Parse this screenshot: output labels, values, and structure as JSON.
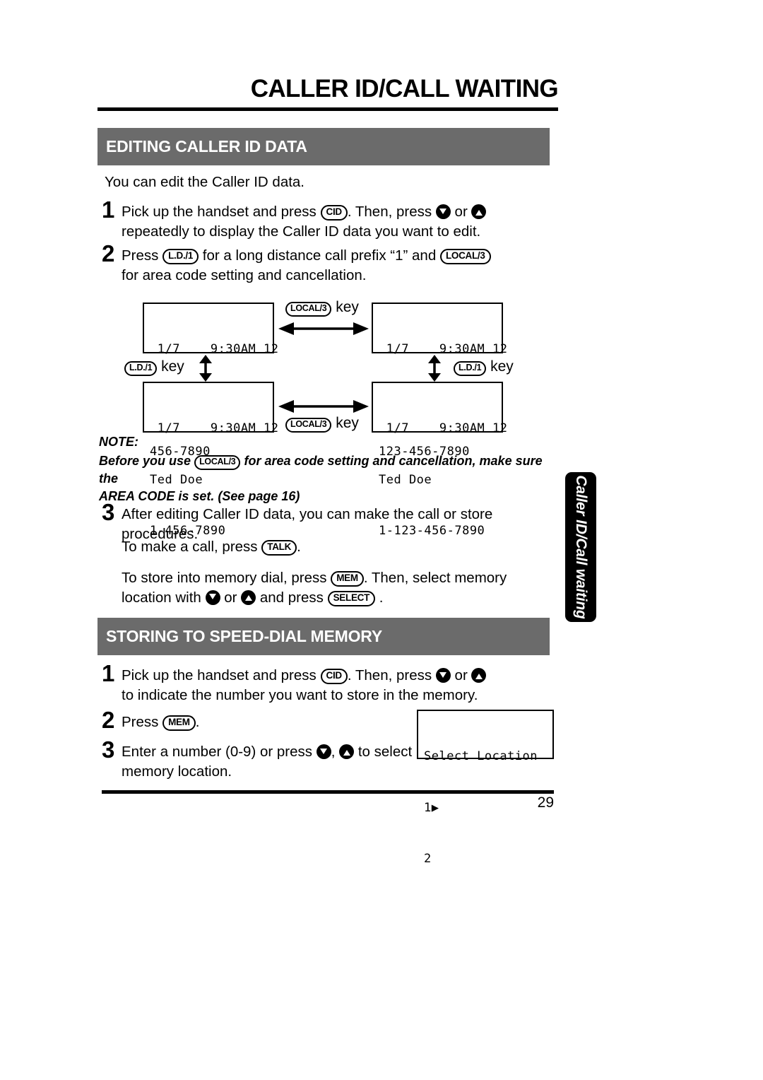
{
  "document": {
    "title": "CALLER ID/CALL WAITING",
    "page_number": "29",
    "side_tab_label": "Caller ID/Call waiting"
  },
  "sections": {
    "editing": {
      "heading": "EDITING CALLER ID DATA",
      "intro": "You can edit the Caller ID data.",
      "step1": {
        "number": "1",
        "part1": "Pick up the handset and press",
        "key_cid": "CID",
        "part2": ". Then, press",
        "part3": "or",
        "part4": "repeatedly to display the Caller ID data you want to edit."
      },
      "step2": {
        "number": "2",
        "part1": "Press",
        "key_ld": "L.D./1",
        "part2": "for a long distance call prefix “1” and",
        "key_local": "LOCAL/3",
        "part3": "for area code setting and cancellation."
      },
      "step3": {
        "number": "3",
        "text": "After editing Caller ID data, you can make the call or store procedures.",
        "call_part1": "To make a call, press",
        "key_talk": "TALK",
        "call_part2": ".",
        "store_part1": "To store into memory dial, press",
        "key_mem": "MEM",
        "store_part2": ". Then, select memory",
        "store_part3": "location with",
        "store_part4": "or",
        "store_part5": "and press",
        "key_select": "SELECT",
        "store_part6": "."
      }
    },
    "storing": {
      "heading": "STORING TO SPEED-DIAL MEMORY",
      "step1": {
        "number": "1",
        "part1": "Pick up the handset and press",
        "key_cid": "CID",
        "part2": ". Then, press",
        "part3": "or",
        "part4": "to indicate the number you want to store in the memory."
      },
      "step2": {
        "number": "2",
        "part1": "Press",
        "key_mem": "MEM",
        "part2": "."
      },
      "step3": {
        "number": "3",
        "part1": "Enter a number (0-9) or press",
        "part2": ",",
        "part3": "to select",
        "part4": "memory location."
      }
    }
  },
  "note": {
    "label": "NOTE:",
    "part1": "Before you use",
    "key_local": "LOCAL/3",
    "part2": "for area code setting and cancellation, make sure the",
    "part3": "AREA CODE is set. (See page 16)"
  },
  "diagram": {
    "displays": {
      "top_left": {
        "line1": " 1/7    9:30AM 12",
        "line2": "Ted Doe",
        "line3": "456-7890"
      },
      "top_right": {
        "line1": " 1/7    9:30AM 12",
        "line2": "Ted Doe",
        "line3": "123-456-7890"
      },
      "bottom_left": {
        "line1": " 1/7    9:30AM 12",
        "line2": "Ted Doe",
        "line3": "1-456-7890"
      },
      "bottom_right": {
        "line1": " 1/7    9:30AM 12",
        "line2": "Ted Doe",
        "line3": "1-123-456-7890"
      }
    },
    "labels": {
      "top_local": {
        "key": "LOCAL/3",
        "word": "key"
      },
      "bottom_local": {
        "key": "LOCAL/3",
        "word": "key"
      },
      "left_ld": {
        "key": "L.D./1",
        "word": "key"
      },
      "right_ld": {
        "key": "L.D./1",
        "word": "key"
      }
    }
  },
  "select_location_display": {
    "line1": "Select Location",
    "line2": "1▶",
    "line3": "2"
  },
  "colors": {
    "section_bar": "#6b6b6b",
    "tab": "#000000",
    "text": "#000000"
  }
}
